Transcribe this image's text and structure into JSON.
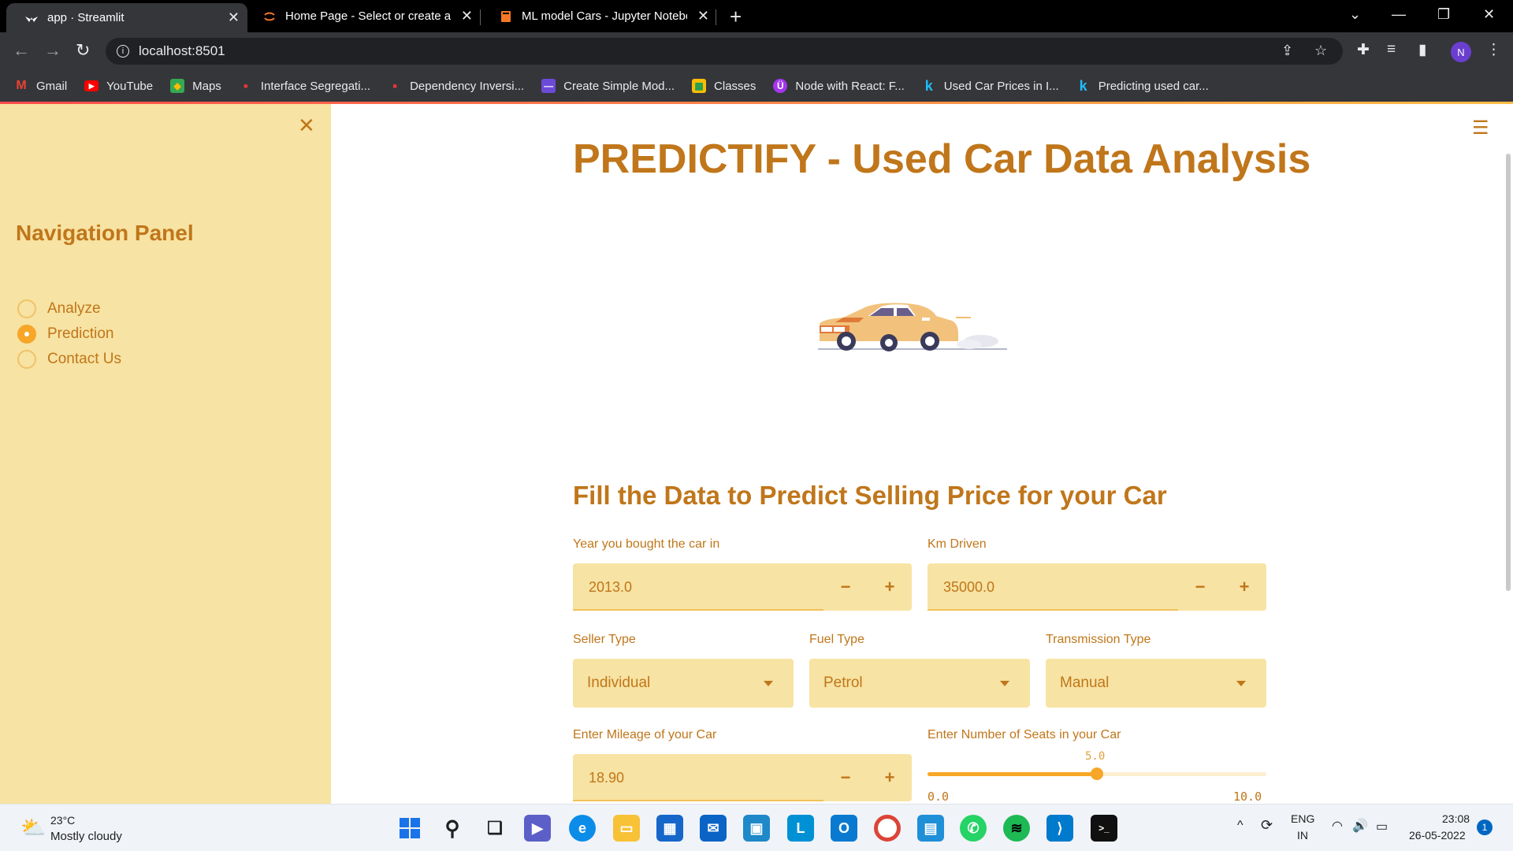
{
  "browser": {
    "tabs": [
      {
        "title": "app · Streamlit",
        "icon": "streamlit-icon"
      },
      {
        "title": "Home Page - Select or create a n",
        "icon": "jupyter-icon"
      },
      {
        "title": "ML model Cars - Jupyter Notebo",
        "icon": "notebook-icon"
      }
    ],
    "url": "localhost:8501",
    "profile_initial": "N",
    "bookmarks": [
      {
        "label": "Gmail",
        "icon": "gmail-icon"
      },
      {
        "label": "YouTube",
        "icon": "youtube-icon"
      },
      {
        "label": "Maps",
        "icon": "maps-icon"
      },
      {
        "label": "Interface Segregati...",
        "icon": "bookmark-icon"
      },
      {
        "label": "Dependency Inversi...",
        "icon": "bookmark-icon"
      },
      {
        "label": "Create Simple Mod...",
        "icon": "bookmark-icon"
      },
      {
        "label": "Classes",
        "icon": "classroom-icon"
      },
      {
        "label": "Node with React: F...",
        "icon": "udemy-icon"
      },
      {
        "label": "Used Car Prices in I...",
        "icon": "kaggle-icon"
      },
      {
        "label": "Predicting used car...",
        "icon": "kaggle-icon"
      }
    ]
  },
  "sidebar": {
    "title": "Navigation Panel",
    "options": [
      {
        "label": "Analyze",
        "selected": false
      },
      {
        "label": "Prediction",
        "selected": true
      },
      {
        "label": "Contact Us",
        "selected": false
      }
    ]
  },
  "main": {
    "title": "PREDICTIFY - Used Car Data Analysis",
    "section_title": "Fill the Data to Predict Selling Price for your Car",
    "fields": {
      "year": {
        "label": "Year you bought the car in",
        "value": "2013.0"
      },
      "km": {
        "label": "Km Driven",
        "value": "35000.0"
      },
      "seller": {
        "label": "Seller Type",
        "value": "Individual"
      },
      "fuel": {
        "label": "Fuel Type",
        "value": "Petrol"
      },
      "transmission": {
        "label": "Transmission Type",
        "value": "Manual"
      },
      "mileage": {
        "label": "Enter Mileage of your Car",
        "value": "18.90"
      },
      "seats": {
        "label": "Enter Number of Seats in your Car",
        "value": "5.0",
        "min": "0.0",
        "max": "10.0",
        "fraction": 0.5
      }
    },
    "stepper_minus": "−",
    "stepper_plus": "+"
  },
  "taskbar": {
    "temperature": "23°C",
    "weather": "Mostly cloudy",
    "language": "ENG",
    "region": "IN",
    "time": "23:08",
    "date": "26-05-2022",
    "notifications": "1"
  },
  "colors": {
    "accent": "#c0761a",
    "sidebar_bg": "#f7e3a3",
    "widget_bg": "#f7e3a3",
    "primary": "#f7a628"
  }
}
